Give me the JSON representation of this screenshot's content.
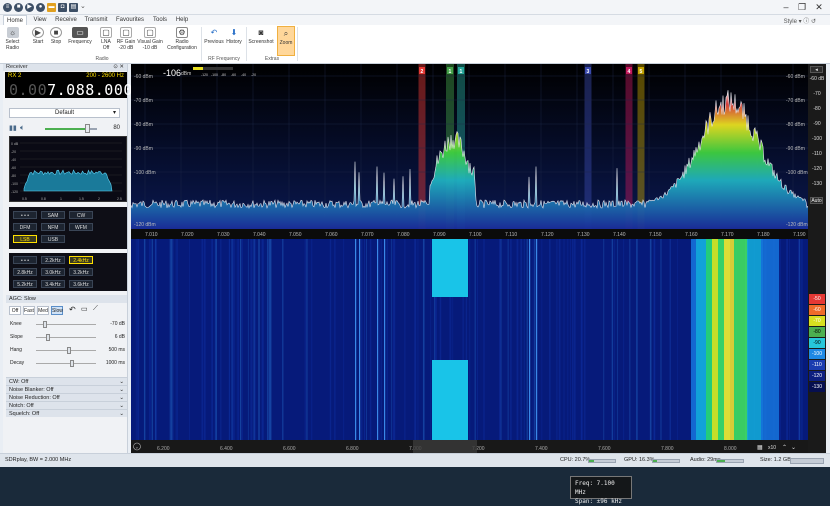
{
  "titlebar": {
    "chevron": "⌄",
    "style_label": "Style"
  },
  "tabs": [
    "Home",
    "View",
    "Receive",
    "Transmit",
    "Favourites",
    "Tools",
    "Help"
  ],
  "ribbon": {
    "radio": [
      {
        "label": "Select\nRadio",
        "icon": "radio-icon"
      },
      {
        "label": "Start",
        "icon": "play-icon"
      },
      {
        "label": "Stop",
        "icon": "stop-icon"
      },
      {
        "label": "Frequency",
        "icon": "frequency-icon"
      },
      {
        "label": "LNA\nOff",
        "icon": "lna-icon"
      },
      {
        "label": "RF Gain\n-20 dB",
        "icon": "rf-gain-icon"
      },
      {
        "label": "Visual Gain\n-10 dB",
        "icon": "visual-gain-icon"
      },
      {
        "label": "Radio\nConfiguration",
        "icon": "config-icon"
      }
    ],
    "rf": [
      {
        "label": "Previous",
        "icon": "undo-icon"
      },
      {
        "label": "History",
        "icon": "history-icon"
      }
    ],
    "extras": [
      {
        "label": "Screenshot",
        "icon": "camera-icon"
      },
      {
        "label": "Zoom",
        "icon": "zoom-icon"
      }
    ],
    "groups": {
      "radio": "Radio",
      "rf": "RF Frequency",
      "extras": "Extras"
    }
  },
  "receiver": {
    "panel_title": "Receiver",
    "rx": "RX 2",
    "range": "200 - 2600 Hz",
    "freq_dim": "0.00",
    "freq_main": "7.088.000",
    "preset": "Default",
    "volume": "80",
    "volume_level": 0.8,
    "modes": [
      [
        "• • •",
        "SAM",
        "CW"
      ],
      [
        "DFM",
        "NFM",
        "WFM"
      ],
      [
        "LSB",
        "USB"
      ]
    ],
    "selected_mode": "LSB",
    "bandwidths": [
      [
        "• • •",
        "2.2kHz",
        "2.4kHz"
      ],
      [
        "2.8kHz",
        "3.0kHz",
        "3.2kHz"
      ],
      [
        "5.2kHz",
        "3.4kHz",
        "3.6kHz"
      ]
    ],
    "selected_bw": "2.4kHz",
    "mini_scale_left": [
      "0 dB",
      "-20",
      "-40",
      "-60",
      "-80",
      "-100",
      "-120"
    ],
    "mini_scale_x": [
      "0.5",
      "0.8",
      "1",
      "1.5",
      "2",
      "2.5"
    ]
  },
  "agc": {
    "title": "AGC: Slow",
    "buttons": [
      "Off",
      "Fast",
      "Med",
      "Slow"
    ],
    "selected": "Slow",
    "rows": [
      {
        "label": "Knee",
        "value": "-70 dB",
        "pos": 0.15
      },
      {
        "label": "Slope",
        "value": "6 dB",
        "pos": 0.2
      },
      {
        "label": "Hang",
        "value": "500 ms",
        "pos": 0.55
      },
      {
        "label": "Decay",
        "value": "1000 ms",
        "pos": 0.6
      }
    ]
  },
  "collapsed": [
    "CW: Off",
    "Noise Blanker: Off",
    "Noise Reduction: Off",
    "Notch: Off",
    "Squelch: Off"
  ],
  "spectrum": {
    "peak_value": "-106",
    "peak_unit": "dBm",
    "level_scale": [
      "-120",
      "-100",
      "-80",
      "-60",
      "-40",
      "-20"
    ],
    "y_left": [
      "-60 dBm",
      "-70 dBm",
      "-80 dBm",
      "-90 dBm",
      "-100 dBm",
      "-120 dBm"
    ],
    "y_right": [
      "-60 dBm",
      "-70 dBm",
      "-80 dBm",
      "-90 dBm",
      "-100 dBm",
      "-120 dBm"
    ],
    "x_ticks": [
      "7.010",
      "7.020",
      "7.030",
      "7.040",
      "7.050",
      "7.060",
      "7.070",
      "7.080",
      "7.090",
      "7.100",
      "7.110",
      "7.120",
      "7.130",
      "7.140",
      "7.150",
      "7.160",
      "7.170",
      "7.180",
      "7.190"
    ],
    "vfo": [
      {
        "n": "2",
        "c": "#e53935"
      },
      {
        "n": "1",
        "c": "#43a047"
      },
      {
        "n": "1",
        "c": "#26a69a"
      },
      {
        "n": "3",
        "c": "#3949ab"
      },
      {
        "n": "4",
        "c": "#c2185b"
      },
      {
        "n": "5",
        "c": "#c0a000"
      }
    ]
  },
  "overview": {
    "ticks": [
      "6.200",
      "6.400",
      "6.600",
      "6.800",
      "7.000",
      "7.200",
      "7.400",
      "7.600",
      "7.800",
      "8.000"
    ],
    "zoom": "x10"
  },
  "tooltip": {
    "freq": "Freq: 7.100 MHz",
    "span": "Span:  ±96 kHz"
  },
  "rangebar": {
    "top": "Auto",
    "labels": [
      "-60 dB",
      "-70",
      "-80",
      "-90",
      "-100",
      "-110",
      "-120",
      "-130"
    ],
    "palette": [
      "-50",
      "-60",
      "-70",
      "-80",
      "-90",
      "-100",
      "-110",
      "-120",
      "-130"
    ]
  },
  "status": {
    "device": "SDRplay, BW = 2.000 MHz",
    "cpu": "CPU: 20.7%",
    "cpu_level": 0.21,
    "gpu": "GPU: 16.3%",
    "gpu_level": 0.16,
    "audio": "Audio: 29ms",
    "audio_level": 0.3,
    "size": "Size: 1.2 GB"
  }
}
